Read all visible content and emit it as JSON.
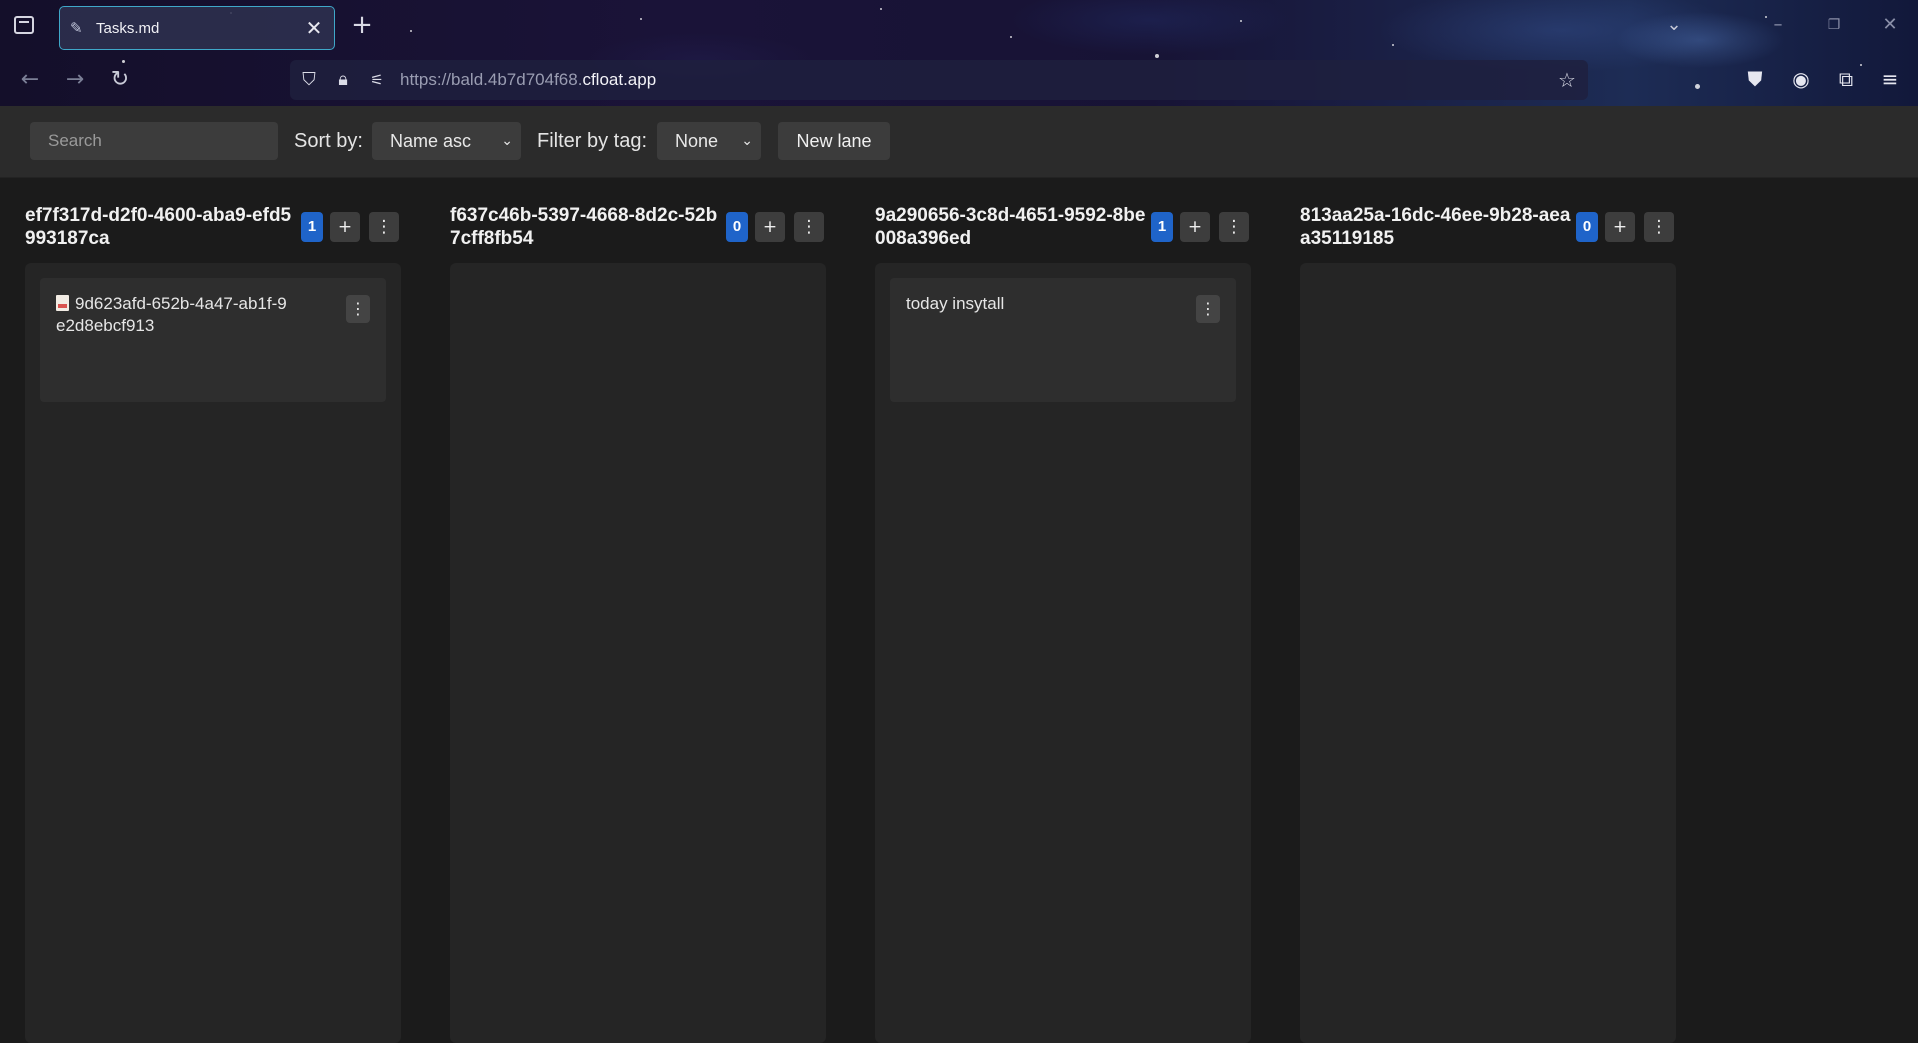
{
  "browser": {
    "tab": {
      "title": "Tasks.md",
      "favicon": "edit-pencil-icon"
    },
    "url": {
      "prefix": "https://bald.4b7d704f68.",
      "host": "cfloat.app"
    }
  },
  "toolbar": {
    "search_placeholder": "Search",
    "sort_label": "Sort by:",
    "sort_value": "Name asc",
    "filter_label": "Filter by tag:",
    "filter_value": "None",
    "new_lane_label": "New lane"
  },
  "lanes": [
    {
      "title": "ef7f317d-d2f0-4600-aba9-efd5993187ca",
      "count": "1",
      "cards": [
        {
          "text": "9d623afd-652b-4a47-ab1f-9e2d8ebcf913",
          "icon": "file-icon"
        }
      ]
    },
    {
      "title": "f637c46b-5397-4668-8d2c-52b7cff8fb54",
      "count": "0",
      "cards": []
    },
    {
      "title": "9a290656-3c8d-4651-9592-8be008a396ed",
      "count": "1",
      "cards": [
        {
          "text": "today insytall"
        }
      ]
    },
    {
      "title": "813aa25a-16dc-46ee-9b28-aeaa35119185",
      "count": "0",
      "cards": []
    }
  ],
  "colors": {
    "accent_badge": "#1f64c9",
    "tab_border": "#3fa8c9"
  }
}
